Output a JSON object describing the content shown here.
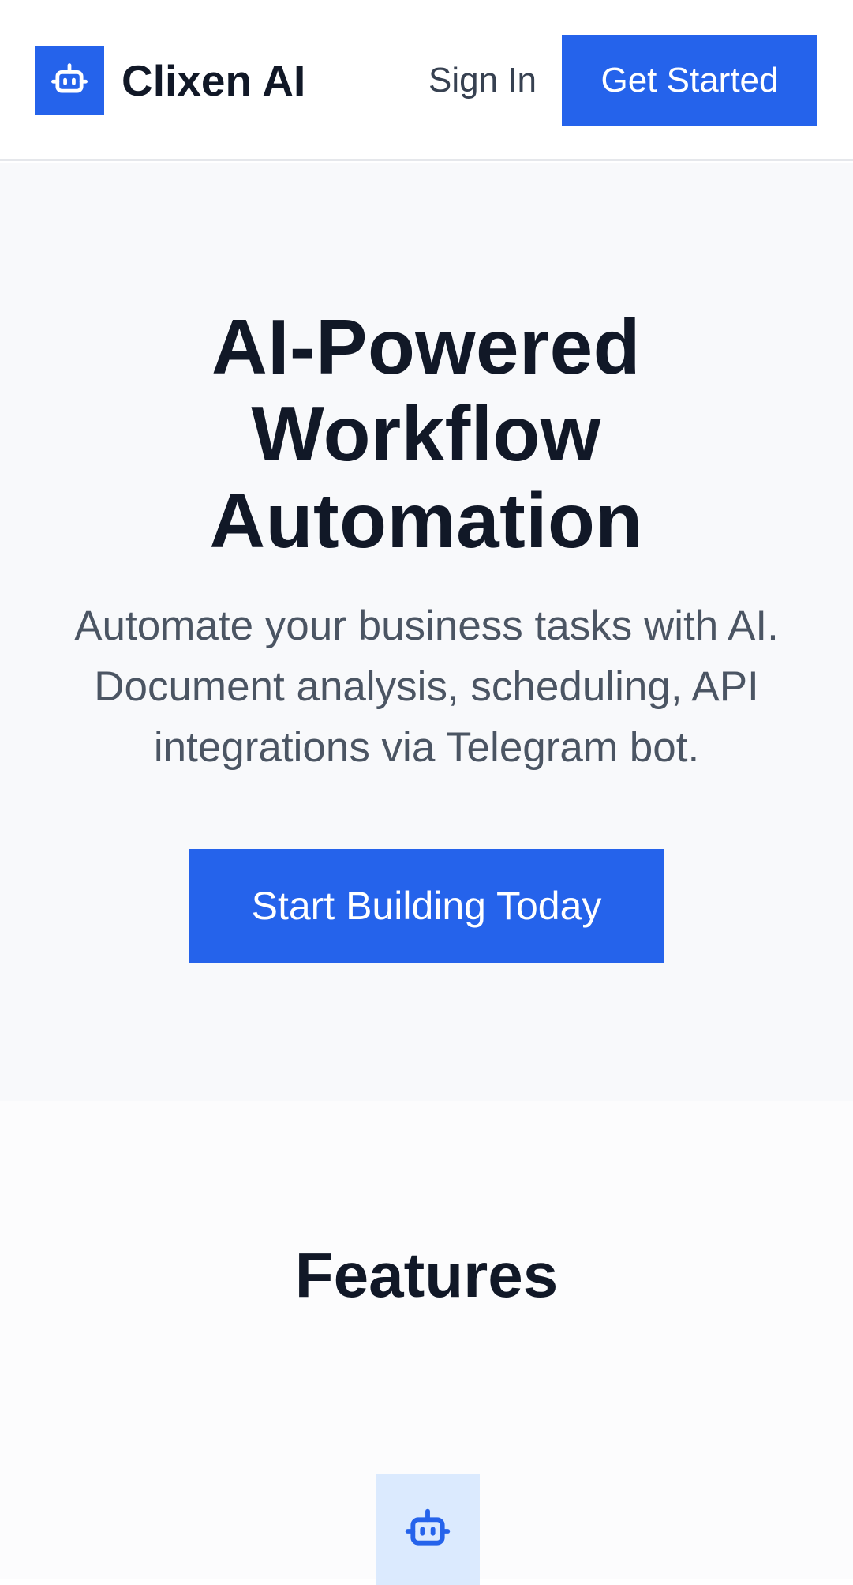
{
  "header": {
    "brand": "Clixen AI",
    "logo_icon": "robot-icon",
    "sign_in": "Sign In",
    "get_started": "Get Started"
  },
  "hero": {
    "title": "AI-Powered Workflow Automation",
    "subtitle": "Automate your business tasks with AI. Document analysis, scheduling, API integrations via Telegram bot.",
    "cta": "Start Building Today"
  },
  "features": {
    "title": "Features",
    "first_icon": "robot-icon"
  },
  "colors": {
    "accent": "#2563eb",
    "hero_bg": "#f8f9fb",
    "icon_tile_bg": "#dbeafe",
    "heading": "#111827",
    "body_text": "#4b5563"
  }
}
